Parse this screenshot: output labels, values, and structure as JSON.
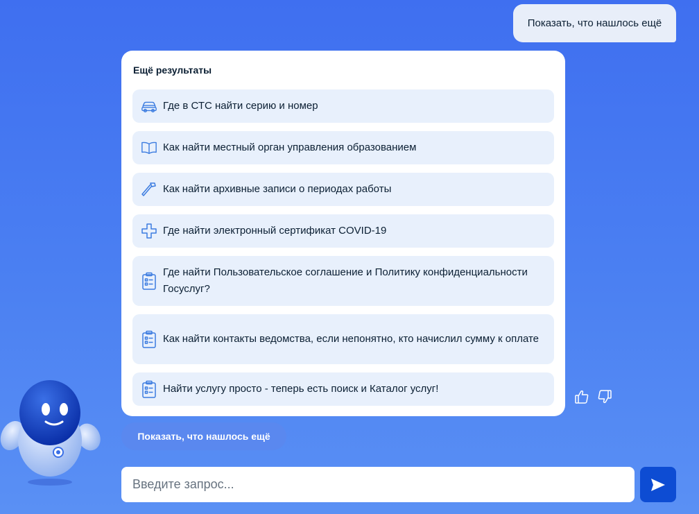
{
  "user_message": {
    "text": "Показать, что нашлось ещё"
  },
  "results_card": {
    "title": "Ещё результаты",
    "items": [
      {
        "icon": "car-icon",
        "label": "Где в СТС найти серию и номер"
      },
      {
        "icon": "book-icon",
        "label": "Как найти местный орган управления образованием"
      },
      {
        "icon": "hammer-icon",
        "label": "Как найти архивные записи о периодах работы"
      },
      {
        "icon": "medical-cross-icon",
        "label": "Где найти электронный сертификат COVID-19"
      },
      {
        "icon": "clipboard-icon",
        "label": "Где найти Пользовательское соглашение и Политику конфиденциальности Госуслуг?"
      },
      {
        "icon": "clipboard-icon",
        "label": "Как найти контакты ведомства, если непонятно, кто начислил сумму к оплате"
      },
      {
        "icon": "clipboard-icon",
        "label": "Найти услугу просто - теперь есть поиск и Каталог услуг!"
      }
    ]
  },
  "feedback": {
    "like_icon": "thumbs-up-icon",
    "dislike_icon": "thumbs-down-icon"
  },
  "show_more_button": {
    "label": "Показать, что нашлось ещё"
  },
  "input": {
    "value": "",
    "placeholder": "Введите запрос..."
  },
  "send_button": {
    "icon": "send-arrow-icon"
  },
  "assistant": {
    "icon": "robot-assistant-icon"
  },
  "colors": {
    "accent": "#0d4cd3",
    "item_bg": "#e8f0fc",
    "icon_stroke": "#3a7be0",
    "text": "#0b1f33"
  }
}
